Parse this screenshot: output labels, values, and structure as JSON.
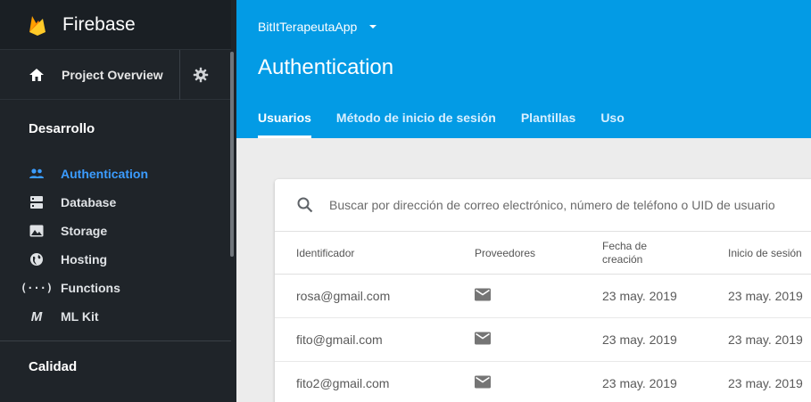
{
  "sidebar": {
    "brand": "Firebase",
    "project_overview": "Project Overview",
    "section_dev": "Desarrollo",
    "items": [
      {
        "label": "Authentication",
        "icon": "people-icon",
        "active": true
      },
      {
        "label": "Database",
        "icon": "database-icon"
      },
      {
        "label": "Storage",
        "icon": "image-icon"
      },
      {
        "label": "Hosting",
        "icon": "globe-icon"
      },
      {
        "label": "Functions",
        "icon": "functions-icon"
      },
      {
        "label": "ML Kit",
        "icon": "ml-kit-icon"
      }
    ],
    "section_quality": "Calidad"
  },
  "header": {
    "project_name": "BitItTerapeutaApp",
    "title": "Authentication",
    "tabs": [
      {
        "label": "Usuarios",
        "active": true
      },
      {
        "label": "Método de inicio de sesión"
      },
      {
        "label": "Plantillas"
      },
      {
        "label": "Uso"
      }
    ]
  },
  "users": {
    "search_placeholder": "Buscar por dirección de correo electrónico, número de teléfono o UID de usuario",
    "columns": [
      "Identificador",
      "Proveedores",
      "Fecha de creación",
      "Inicio de sesión"
    ],
    "rows": [
      {
        "identifier": "rosa@gmail.com",
        "provider": "mail-icon",
        "created": "23 may. 2019",
        "signed_in": "23 may. 2019"
      },
      {
        "identifier": "fito@gmail.com",
        "provider": "mail-icon",
        "created": "23 may. 2019",
        "signed_in": "23 may. 2019"
      },
      {
        "identifier": "fito2@gmail.com",
        "provider": "mail-icon",
        "created": "23 may. 2019",
        "signed_in": "23 may. 2019"
      }
    ]
  },
  "colors": {
    "accent": "#039be5",
    "sidebar": "#1f2429",
    "active_nav": "#3b9cff"
  }
}
